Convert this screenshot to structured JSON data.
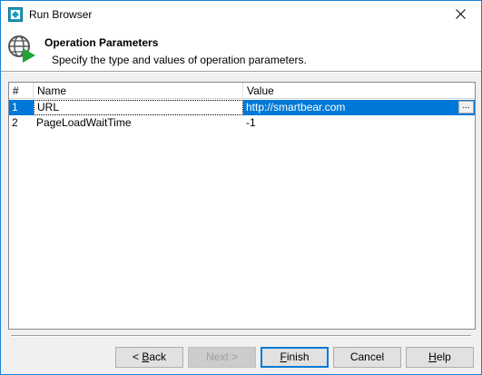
{
  "window": {
    "title": "Run Browser",
    "close_glyph": "✕"
  },
  "header": {
    "title": "Operation Parameters",
    "subtitle": "Specify the type and values of operation parameters.",
    "icon": "globe-play-icon"
  },
  "grid": {
    "columns": [
      "#",
      "Name",
      "Value"
    ],
    "rows": [
      {
        "num": "1",
        "name": "URL",
        "value": "http://smartbear.com",
        "selected": true
      },
      {
        "num": "2",
        "name": "PageLoadWaitTime",
        "value": "-1",
        "selected": false
      }
    ],
    "ellipsis_label": "..."
  },
  "buttons": {
    "back": {
      "pre": "< ",
      "key": "B",
      "post": "ack"
    },
    "next": "Next >",
    "finish": {
      "pre": "",
      "key": "F",
      "post": "inish"
    },
    "cancel": "Cancel",
    "help": {
      "pre": "",
      "key": "H",
      "post": "elp"
    }
  },
  "colors": {
    "selection": "#0078d7",
    "window_border": "#1883d7",
    "play_green": "#1fa336"
  }
}
